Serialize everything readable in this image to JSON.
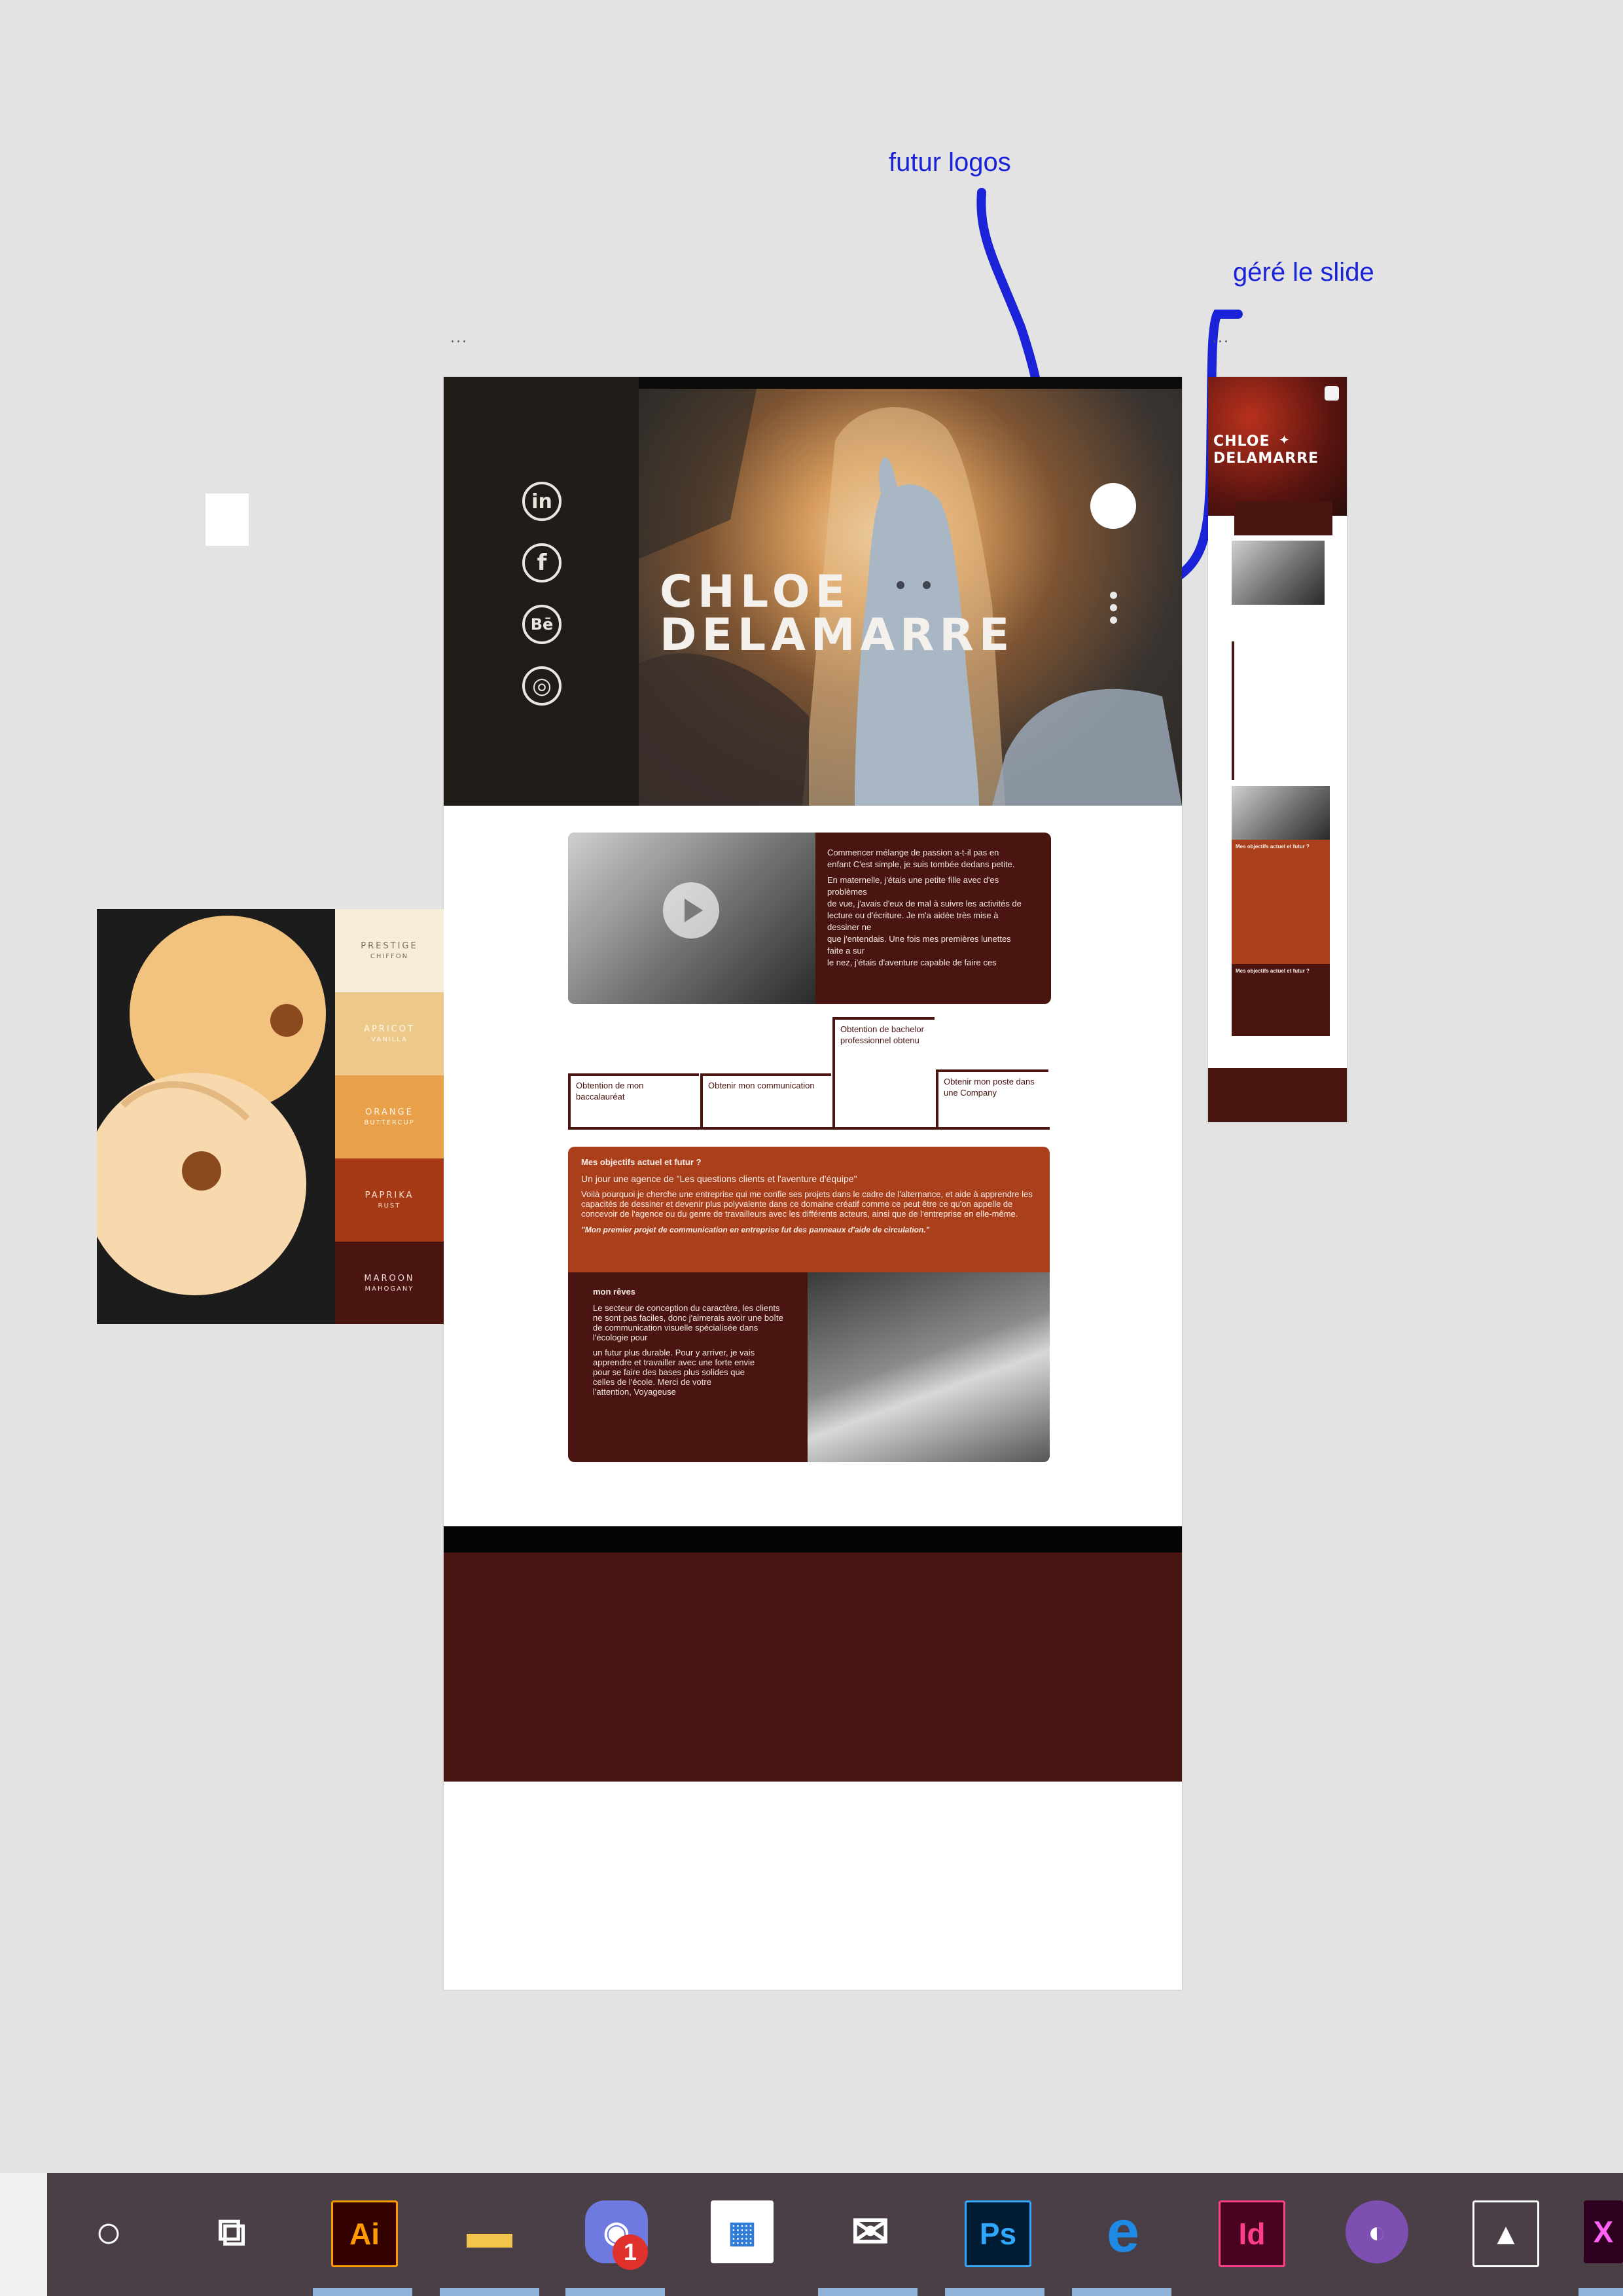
{
  "annotations": {
    "futur_logos": "futur logos",
    "gere_le_slide": "géré le slide",
    "artboard_label_desktop": "...",
    "artboard_label_mobile": "..."
  },
  "desktop": {
    "hero": {
      "title_line1": "CHLOE",
      "title_line2": "DELAMARRE"
    },
    "social_icons": [
      {
        "name": "linkedin-icon",
        "glyph": "in"
      },
      {
        "name": "facebook-icon",
        "glyph": "f"
      },
      {
        "name": "behance-icon",
        "glyph": "Bē"
      },
      {
        "name": "instagram-icon",
        "glyph": "◎"
      }
    ],
    "intro_text": [
      "Commencer mélange de passion a-t-il pas en",
      "enfant C'est simple, je suis tombée dedans petite.",
      "En maternelle, j'étais une petite fille avec d'es",
      "problèmes",
      "de vue, j'avais d'eux de mal à suivre les activités de",
      "lecture ou d'écriture. Je m'a aidée très mise à",
      "dessiner ne",
      "que j'entendais. Une fois mes premières lunettes",
      "faite a sur",
      "le nez, j'étais d'aventure capable de faire ces"
    ],
    "timeline": [
      "Obtention de mon baccalauréat",
      "Obtenir mon communication",
      "Obtention de bachelor professionnel obtenu",
      "Obtenir mon poste dans une Company"
    ],
    "objectifs": {
      "title": "Mes objectifs actuel et futur ?",
      "subtitle": "Un jour une agence de \"Les questions clients et l'aventure d'équipe\"",
      "body": "Voilà pourquoi je cherche une entreprise qui me confie ses projets dans le cadre de l'alternance, et aide à apprendre les capacités de dessiner et devenir plus polyvalente dans ce domaine créatif comme ce peut être ce qu'on appelle de concevoir de l'agence ou du genre de travailleurs avec les différents acteurs, ainsi que de l'entreprise en elle-même.",
      "quote": "\"Mon premier projet de communication en entreprise fut des panneaux d'aide de circulation.\""
    },
    "reves": {
      "title": "mon rêves",
      "lines": [
        "Le secteur de conception du caractère, les clients",
        "ne sont pas faciles, donc j'aimerais avoir une boîte",
        "de communication visuelle spécialisée dans",
        "l'écologie pour",
        "un futur plus durable. Pour y arriver, je vais",
        "apprendre et travailler avec une forte envie",
        "pour se faire des bases plus solides que",
        "celles de l'école. Merci de votre",
        "l'attention, Voyageuse"
      ]
    }
  },
  "mobile": {
    "title_line1": "CHLOE",
    "title_line2": "DELAMARRE",
    "section_title": "Mes objectifs actuel et futur ?",
    "section_title2": "Mes objectifs actuel et futur ?"
  },
  "palette": {
    "swatches": [
      {
        "name": "PRESTIGE",
        "sub": "CHIFFON",
        "color": "#f7ecd9",
        "text": "#7a6a55"
      },
      {
        "name": "APRICOT",
        "sub": "VANILLA",
        "color": "#ecc98a",
        "text": "#fff7e6"
      },
      {
        "name": "ORANGE",
        "sub": "BUTTERCUP",
        "color": "#e9a04a",
        "text": "#fff4e2"
      },
      {
        "name": "PAPRIKA",
        "sub": "RUST",
        "color": "#a63a17",
        "text": "#f6dccf"
      },
      {
        "name": "MAROON",
        "sub": "MAHOGANY",
        "color": "#4a1510",
        "text": "#f2d9d2"
      }
    ]
  },
  "taskbar": {
    "items": [
      {
        "name": "cortana-icon",
        "glyph": "○"
      },
      {
        "name": "task-view-icon",
        "glyph": "⧉"
      },
      {
        "name": "illustrator-icon",
        "glyph": "Ai"
      },
      {
        "name": "file-explorer-icon",
        "glyph": "▬"
      },
      {
        "name": "discord-icon",
        "glyph": "◉"
      },
      {
        "name": "store-icon",
        "glyph": "▦"
      },
      {
        "name": "mail-icon",
        "glyph": "✉"
      },
      {
        "name": "photoshop-icon",
        "glyph": "Ps"
      },
      {
        "name": "edge-icon",
        "glyph": "e"
      },
      {
        "name": "indesign-icon",
        "glyph": "Id"
      },
      {
        "name": "github-icon",
        "glyph": "◐"
      },
      {
        "name": "photos-icon",
        "glyph": "▲"
      },
      {
        "name": "xd-icon",
        "glyph": "X"
      }
    ],
    "discord_badge": "1"
  },
  "colors": {
    "accent_blue": "#1a23d8",
    "maroon": "#4a1510",
    "rust": "#a93f1b"
  }
}
